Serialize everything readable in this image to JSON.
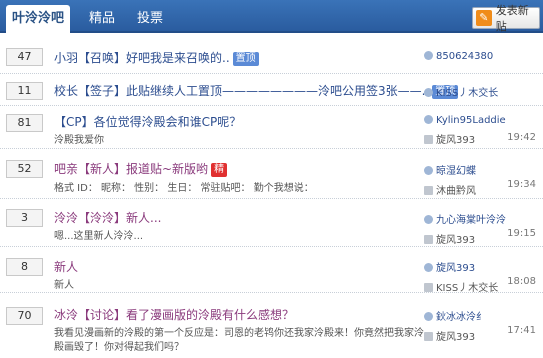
{
  "tabs": [
    {
      "label": "叶泠泠吧"
    },
    {
      "label": "精品"
    },
    {
      "label": "投票"
    }
  ],
  "new_post_label": "发表新贴",
  "threads": [
    {
      "count": "47",
      "title": "小羽【召唤】好吧我是来召唤的..",
      "tag": "置顶",
      "author": "850624380",
      "last": "",
      "time": ""
    },
    {
      "count": "11",
      "title": "校长【签子】此贴继续人工置顶————————泠吧公用签3张——..",
      "tag": "置顶",
      "author": "KISS丿木交长",
      "last": "",
      "time": ""
    },
    {
      "count": "81",
      "title": "【CP】各位觉得泠殿会和谁CP呢？",
      "sub": "泠殿我爱你",
      "author": "Kylin95Laddie",
      "last": "旋风393",
      "time": "19:42"
    },
    {
      "count": "52",
      "title": "吧亲【新人】报道贴~新版哟",
      "tag": "精",
      "sub": "格式  ID：  昵称：  性别：  生日：  常驻贴吧：  勤个我想说：",
      "author": "晾湿幻蝶",
      "last": "沐曲黔风",
      "time": "19:34"
    },
    {
      "count": "3",
      "title": "泠泠【泠泠】新人...",
      "sub": "嗯...这里新人泠泠...",
      "author": "九心海棠叶泠泠",
      "last": "旋风393",
      "time": "19:15"
    },
    {
      "count": "8",
      "title": "新人",
      "sub": "新人",
      "author": "旋风393",
      "last": "KISS丿木交长",
      "time": "18:08"
    },
    {
      "count": "70",
      "title": "冰泠【讨论】看了漫画版的泠殿有什么感想？",
      "sub": "我看见漫画新的泠殿的第一个反应是：司恩的老鸨你还我家泠殿来！你竟然把我家泠",
      "sub2": "殿画毁了！你对得起我们吗？",
      "author": "鈥冰冰泠纟",
      "last": "旋风393",
      "time": "17:41"
    }
  ]
}
